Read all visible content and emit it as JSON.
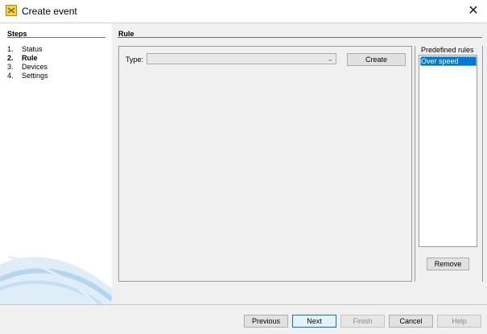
{
  "window": {
    "title": "Create event",
    "close_glyph": "✕",
    "app_icon": "event-app-icon"
  },
  "steps": {
    "heading": "Steps",
    "items": [
      {
        "num": "1.",
        "label": "Status",
        "active": false
      },
      {
        "num": "2.",
        "label": "Rule",
        "active": true
      },
      {
        "num": "3.",
        "label": "Devices",
        "active": false
      },
      {
        "num": "4.",
        "label": "Settings",
        "active": false
      }
    ]
  },
  "rule": {
    "heading": "Rule",
    "type_label": "Type:",
    "type_value": "",
    "create_label": "Create",
    "chevron_glyph": "⌄"
  },
  "predefined": {
    "label": "Predefined rules",
    "items": [
      "Over speed"
    ],
    "selected": "Over speed",
    "remove_label": "Remove"
  },
  "footer": {
    "previous_label": "Previous",
    "next_label": "Next",
    "finish_label": "Finish",
    "cancel_label": "Cancel",
    "help_label": "Help"
  },
  "colors": {
    "accent": "#0078d7",
    "selection_text": "#ffffff",
    "panel_bg": "#f0f0f0"
  }
}
